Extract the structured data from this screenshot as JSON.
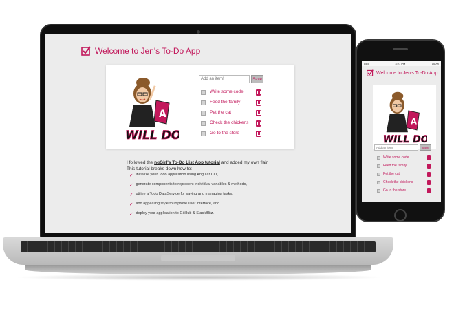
{
  "app": {
    "title": "Welcome to Jen's To-Do App",
    "logo_text": "WILL DO",
    "logo_badge": "A"
  },
  "form": {
    "placeholder": "Add an item!",
    "save_label": "Save"
  },
  "todos": [
    {
      "label": "Write some code"
    },
    {
      "label": "Feed the family"
    },
    {
      "label": "Pet the cat"
    },
    {
      "label": "Check the chickens"
    },
    {
      "label": "Go to the store"
    }
  ],
  "info": {
    "intro_before": "I followed the ",
    "link_text": "ngGirl's To-Do List App tutorial",
    "intro_after": " and added my own flair.",
    "intro_line2": "This tutorial breaks down how to:",
    "steps": [
      "initialize your Todo application using Angular CLI,",
      "generate components to represent individual variables & methods,",
      "utilize a Todo DataService for saving and managing tasks,",
      "add appealing style to improve user interface, and",
      "deploy your application to GitHub & StackBlitz."
    ],
    "check_mark": "✓"
  },
  "phone": {
    "carrier": "•••••",
    "time": "4:21 PM",
    "battery": "100%"
  },
  "colors": {
    "accent": "#c2185b",
    "screen_bg": "#ececec",
    "card_bg": "#ffffff"
  }
}
